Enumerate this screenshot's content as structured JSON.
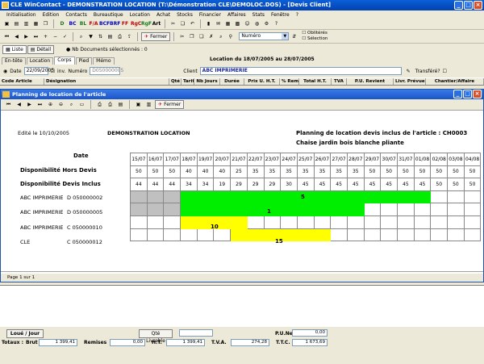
{
  "window": {
    "title": "CLE WinContact - DEMONSTRATION LOCATION (T:\\Démonstration CLE\\DEMOLOC.DOS) - [Devis Client]"
  },
  "menu": [
    "Initialisation",
    "Edition",
    "Contacts",
    "Bureautique",
    "Location",
    "Achat",
    "Stocks",
    "Financier",
    "Affaires",
    "Stats",
    "Fenêtre",
    "?"
  ],
  "toolbar1": {
    "docs": [
      "D",
      "BC",
      "BL",
      "F/A",
      "BCF",
      "BRF",
      "FF",
      "RgC",
      "RgF",
      "Art"
    ]
  },
  "toolbar2": {
    "fermer": "Fermer",
    "numero_value": "Numéro",
    "oblitere": "Oblitérés",
    "selection": "Sélection"
  },
  "toolbar3": {
    "liste": "Liste",
    "detail": "Détail",
    "nb_docs": "Nb Documents sélectionnés : 0"
  },
  "tabs": [
    "En-tête",
    "Location",
    "Corps",
    "Pied",
    "Mémo"
  ],
  "location_period": "Location du 18/07/2005 au 28/07/2005",
  "doc": {
    "date_label": "Date",
    "date_value": "22/09/2005",
    "inv_label": "inv.",
    "numero_label": "Numéro",
    "numero_value": "D050000005",
    "client_label": "Client",
    "client_value": "ABC IMPRIMERIE",
    "transfere": "Transféré?"
  },
  "grid_headers": [
    "Code Article",
    "Désignation",
    "Qté",
    "Tarif",
    "Nb Jours",
    "Durée",
    "Prix U. H.T.",
    "% Rem",
    "Total H.T.",
    "TVA",
    "P.U. Revient",
    "Livr. Prévue",
    "Chantier/Affaire"
  ],
  "child": {
    "title": "Planning de location de l'article",
    "fermer": "Fermer",
    "edited": "Edité le 10/10/2005",
    "company": "DEMONSTRATION LOCATION",
    "heading": "Planning de location devis inclus de l'article : CH0003",
    "article": "Chaise jardin bois blanche pliante",
    "row_date": "Date",
    "row_dispo": "Disponibilité Hors Devis",
    "row_dispo_inc": "Disponibilité Devis Inclus",
    "dates": [
      "15/07",
      "16/07",
      "17/07",
      "18/07",
      "19/07",
      "20/07",
      "21/07",
      "22/07",
      "23/07",
      "24/07",
      "25/07",
      "26/07",
      "27/07",
      "28/07",
      "29/07",
      "30/07",
      "31/07",
      "01/08",
      "02/08",
      "03/08",
      "04/08"
    ],
    "dispo_hors": [
      "50",
      "50",
      "50",
      "40",
      "40",
      "40",
      "25",
      "35",
      "35",
      "35",
      "35",
      "35",
      "35",
      "35",
      "50",
      "50",
      "50",
      "50",
      "50",
      "50",
      "50"
    ],
    "dispo_inc": [
      "44",
      "44",
      "44",
      "34",
      "34",
      "19",
      "29",
      "29",
      "29",
      "30",
      "45",
      "45",
      "45",
      "45",
      "45",
      "45",
      "45",
      "45",
      "50",
      "50",
      "50"
    ],
    "rows": [
      {
        "client": "ABC IMPRIMERIE",
        "doc": "D 050000002",
        "qty": "5"
      },
      {
        "client": "ABC IMPRIMERIE",
        "doc": "D 050000005",
        "qty": "1"
      },
      {
        "client": "ABC IMPRIMERIE",
        "doc": "C 050000010",
        "qty": "10"
      },
      {
        "client": "CLE",
        "doc": "C 050000012",
        "qty": "15"
      }
    ],
    "page": "Page 1 sur 1"
  },
  "footer": {
    "loue_jour": "Loué / Jour",
    "qte_livrable": "Qté Livrable",
    "pu_net": "P.U.Net",
    "pu_net_value": "0,00",
    "totaux": "Totaux :",
    "brut": "Brut",
    "brut_value": "1 399,41",
    "remises": "Remises",
    "remises_value": "0,00",
    "ht": "H.T.",
    "ht_value": "1 399,41",
    "tva": "T.V.A.",
    "tva_value": "274,28",
    "ttc": "T.T.C.",
    "ttc_value": "1 673,69"
  },
  "colors": {
    "green": "#00ee00",
    "yellow": "#ffff00",
    "gray": "#c0c0c0",
    "title_blue": "#0a5fd8"
  }
}
